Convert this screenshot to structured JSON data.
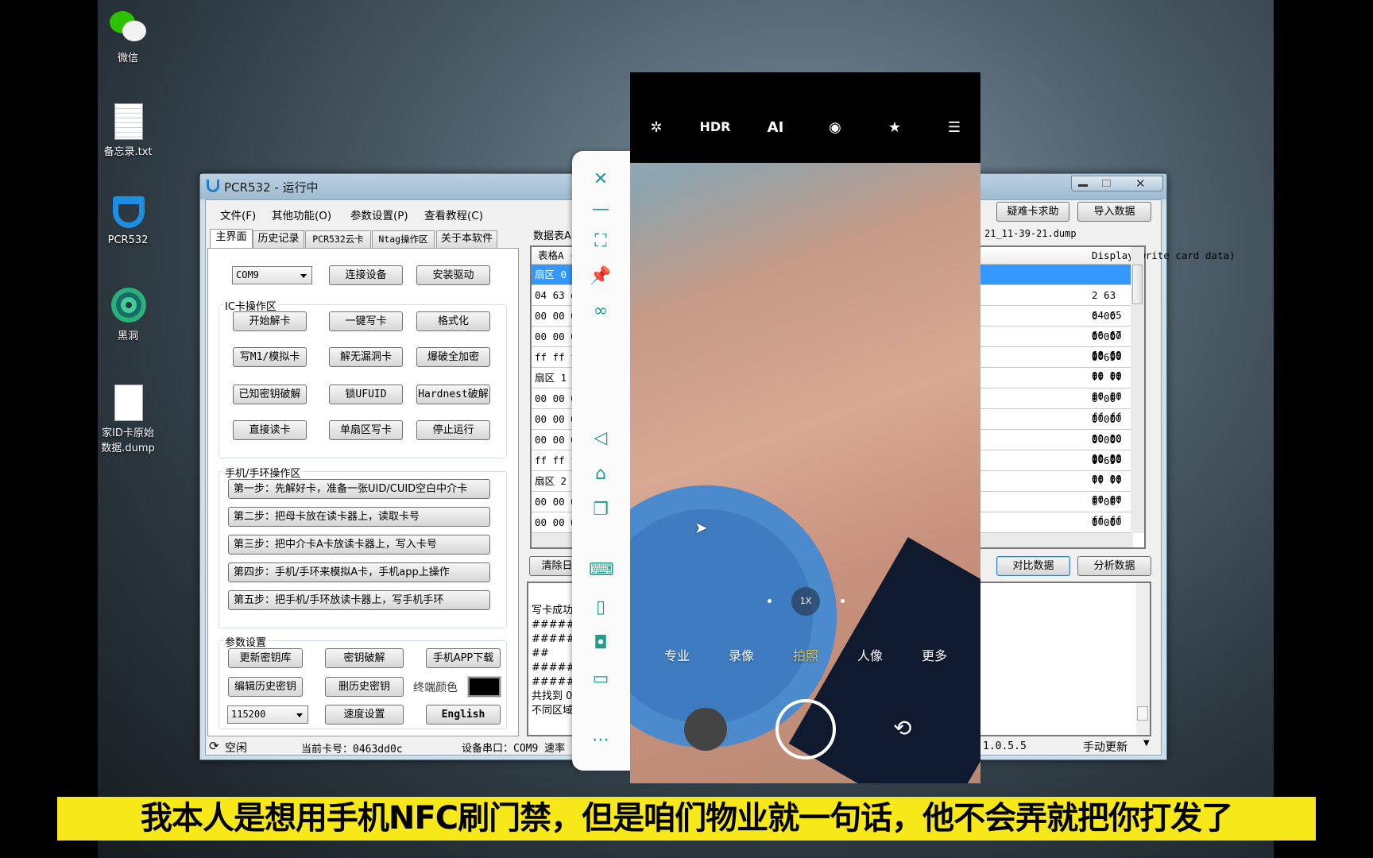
{
  "desktop": {
    "icons": [
      {
        "label": "微信",
        "icon": "wechat-icon"
      },
      {
        "label": "备忘录.txt",
        "icon": "text-file-icon"
      },
      {
        "label": "PCR532",
        "icon": "pcr532-app-icon"
      },
      {
        "label": "黑洞",
        "icon": "blackhole-app-icon"
      },
      {
        "label": "家ID卡原始数据.dump",
        "label1": "家ID卡原始",
        "label2": "数据.dump",
        "icon": "file-icon"
      }
    ]
  },
  "window": {
    "title": "PCR532 - 运行中",
    "menu": [
      "文件(F)",
      "其他功能(O)",
      "参数设置(P)",
      "查看教程(C)"
    ],
    "tabs": [
      "主界面",
      "历史记录",
      "PCR532云卡",
      "Ntag操作区",
      "关于本软件"
    ],
    "port_select": "COM9",
    "connect": "连接设备",
    "install_driver": "安装驱动",
    "ic_group": {
      "label": "IC卡操作区",
      "buttons": [
        [
          "开始解卡",
          "一键写卡",
          "格式化"
        ],
        [
          "写M1/模拟卡",
          "解无漏洞卡",
          "爆破全加密"
        ],
        [
          "已知密钥破解",
          "锁UFUID",
          "Hardnest破解"
        ],
        [
          "直接读卡",
          "单扇区写卡",
          "停止运行"
        ]
      ]
    },
    "phone_group": {
      "label": "手机/手环操作区",
      "steps": [
        "第一步：先解好卡，准备一张UID/CUID空白中介卡",
        "第二步：把母卡放在读卡器上，读取卡号",
        "第三步：把中介卡A卡放读卡器上，写入卡号",
        "第四步：手机/手环来模拟A卡，手机app上操作",
        "第五步：把手机/手环放读卡器上，写手机手环"
      ]
    },
    "params_group": {
      "label": "参数设置",
      "update_keys": "更新密钥库",
      "key_crack": "密钥破解",
      "app_download": "手机APP下载",
      "edit_history_keys": "编辑历史密钥",
      "delete_history_keys": "删历史密钥",
      "terminal_color_label": "终端颜色",
      "terminal_color": "#000000",
      "baud_select": "115200",
      "speed": "速度设置",
      "english": "English"
    },
    "right": {
      "help": "疑难卡求助",
      "import": "导入数据",
      "table_label": "数据表A",
      "file_suffix": "21_11-39-21.dump",
      "header_left": "表格A (",
      "header_right": "Display write card data)",
      "rows": [
        {
          "l": "扇区 0",
          "r": "",
          "sel": true
        },
        {
          "l": "04 63 dd",
          "r": "2 63 64 65 66 67 68 69"
        },
        {
          "l": "00 00 00",
          "r": "0 00 00 00 00 00 00 00"
        },
        {
          "l": "00 00 00",
          "r": "0 00 00 00 00 00 00 00"
        },
        {
          "l": "ff ff ff",
          "r": "0 69 ff ff ff ff ff ff"
        },
        {
          "l": "扇区 1",
          "r": ""
        },
        {
          "l": "00 00 00",
          "r": "0 00 00 00 00 00 00 00"
        },
        {
          "l": "00 00 00",
          "r": "0 00 00 00 00 00 00 00"
        },
        {
          "l": "00 00 00",
          "r": "0 00 00 00 00 00 00 00"
        },
        {
          "l": "ff ff ff",
          "r": "0 69 ff ff ff ff ff ff"
        },
        {
          "l": "扇区 2",
          "r": ""
        },
        {
          "l": "00 00 00",
          "r": "0 00 00 00 00 00 00 00"
        },
        {
          "l": "00 00 00",
          "r": "0 00 00 00 00 00 00 00"
        }
      ],
      "clear_log": "清除日",
      "compare": "对比数据",
      "analyze": "分析数据",
      "log": [
        "写卡成功",
        "########",
        "########",
        "##",
        "########",
        "########",
        "共找到 0",
        "不同区域"
      ]
    },
    "status": {
      "state": "空闲",
      "card_no": "当前卡号：0463dd0c",
      "port": "设备串口：COM9 速率",
      "version": "1.0.5.5",
      "update_mode": "手动更新"
    }
  },
  "phone_toolbar": [
    "close-icon",
    "minimize-icon",
    "fullscreen-icon",
    "pin-icon",
    "link-add-icon",
    "back-icon",
    "home-icon",
    "multi-window-icon",
    "keyboard-icon",
    "phone-icon",
    "camera-icon",
    "folder-icon",
    "more-icon"
  ],
  "camera": {
    "top_icons": {
      "hdr": "HDR",
      "ai": "AI"
    },
    "zoom": "1X",
    "modes": [
      "专业",
      "录像",
      "拍照",
      "人像",
      "更多"
    ],
    "active_mode": "拍照",
    "active_color": "#e8c23a"
  },
  "subtitle": "我本人是想用手机NFC刷门禁，但是咱们物业就一句话，他不会弄就把你打发了",
  "colors": {
    "subtitle_bg": "#f7e81a",
    "toolbar_accent": "#1f9c8c",
    "selection": "#3399ff"
  }
}
